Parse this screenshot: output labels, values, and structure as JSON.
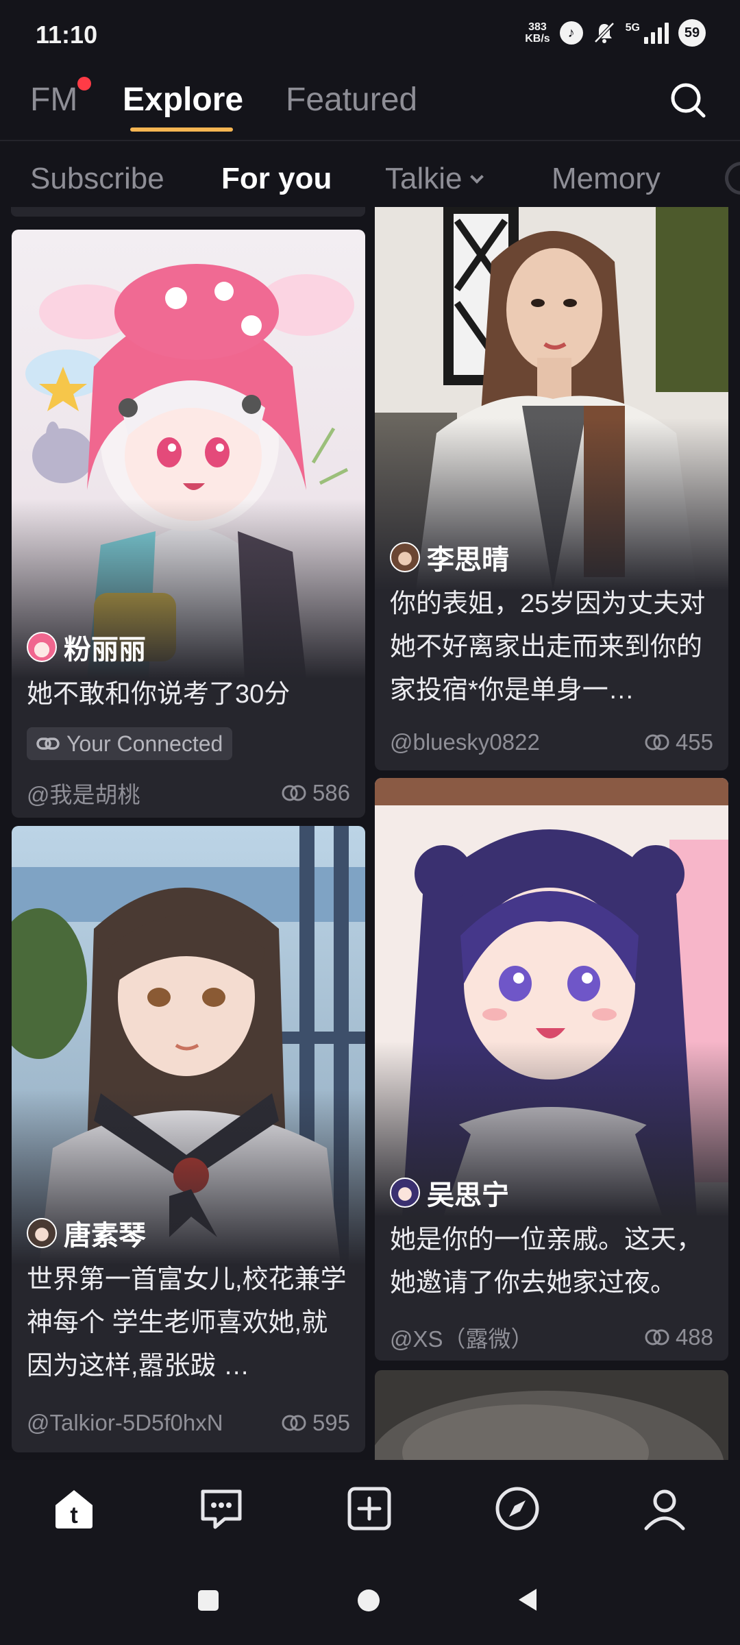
{
  "status_bar": {
    "time": "11:10",
    "net_speed_value": "383",
    "net_speed_unit": "KB/s",
    "network_label": "5G",
    "battery": "59"
  },
  "top_nav": {
    "tabs": [
      {
        "label": "FM",
        "has_notification_dot": true
      },
      {
        "label": "Explore",
        "active": true
      },
      {
        "label": "Featured"
      }
    ],
    "accent_color": "#f5b552",
    "dot_color": "#ff3b46"
  },
  "sub_nav": {
    "tabs": [
      {
        "label": "Subscribe"
      },
      {
        "label": "For you",
        "active": true
      },
      {
        "label": "Talkie",
        "has_dropdown": true
      },
      {
        "label": "Memory"
      }
    ]
  },
  "cards": [
    {
      "name": "粉丽丽",
      "description": "她不敢和你说考了30分",
      "badge": "Your Connected",
      "author": "@我是胡桃",
      "count": "586"
    },
    {
      "name": "李思晴",
      "description": "你的表姐，25岁因为丈夫对她不好离家出走而来到你的家投宿*你是单身一…",
      "author": "@bluesky0822",
      "count": "455"
    },
    {
      "name": "唐素琴",
      "description": "世界第一首富女儿,校花兼学神每个 学生老师喜欢她,就因为这样,嚣张跋 …",
      "author": "@Talkior-5D5f0hxN",
      "count": "595"
    },
    {
      "name": "吴思宁",
      "description": "她是你的一位亲戚。这天，她邀请了你去她家过夜。",
      "author": "@XS（露微）",
      "count": "488"
    }
  ],
  "bottom_nav": {
    "items": [
      {
        "icon": "home-icon",
        "active": true
      },
      {
        "icon": "chat-icon"
      },
      {
        "icon": "create-icon"
      },
      {
        "icon": "compass-icon"
      },
      {
        "icon": "profile-icon"
      }
    ]
  },
  "system_nav": {
    "items": [
      "recents-icon",
      "home-circle-icon",
      "back-icon"
    ]
  }
}
